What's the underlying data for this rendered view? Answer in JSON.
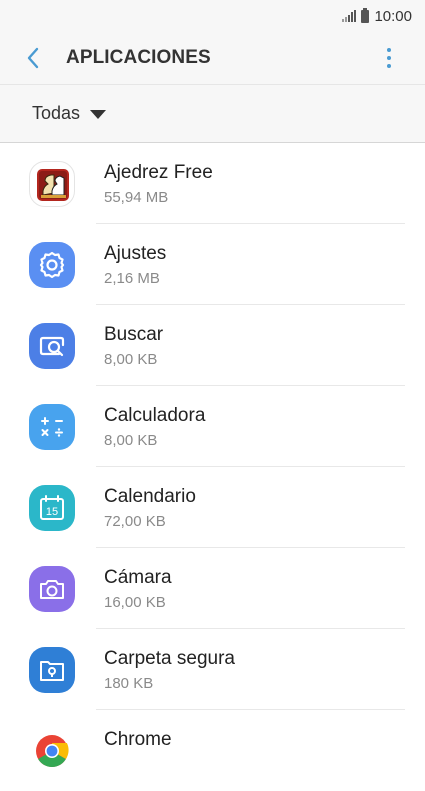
{
  "status_bar": {
    "time": "10:00",
    "icons": [
      "signal-icon",
      "battery-icon"
    ]
  },
  "app_bar": {
    "back_icon": "back-arrow-icon",
    "title": "APLICACIONES",
    "more_icon": "more-vert-icon"
  },
  "filter": {
    "label": "Todas",
    "icon": "caret-down-icon"
  },
  "apps": [
    {
      "name": "Ajedrez Free",
      "size": "55,94 MB",
      "icon": "chess-icon",
      "color": "#c0392b"
    },
    {
      "name": "Ajustes",
      "size": "2,16 MB",
      "icon": "gear-icon",
      "color": "#5a8ff2"
    },
    {
      "name": "Buscar",
      "size": "8,00 KB",
      "icon": "search-icon",
      "color": "#4c7fe6"
    },
    {
      "name": "Calculadora",
      "size": "8,00 KB",
      "icon": "calculator-icon",
      "color": "#48a3ee"
    },
    {
      "name": "Calendario",
      "size": "72,00 KB",
      "icon": "calendar-icon",
      "color": "#2bb7c9"
    },
    {
      "name": "Cámara",
      "size": "16,00 KB",
      "icon": "camera-icon",
      "color": "#8a6fe8"
    },
    {
      "name": "Carpeta segura",
      "size": "180 KB",
      "icon": "secure-folder-icon",
      "color": "#2f7fd6"
    },
    {
      "name": "Chrome",
      "size": "",
      "icon": "chrome-icon",
      "color": "#ea4335"
    }
  ]
}
